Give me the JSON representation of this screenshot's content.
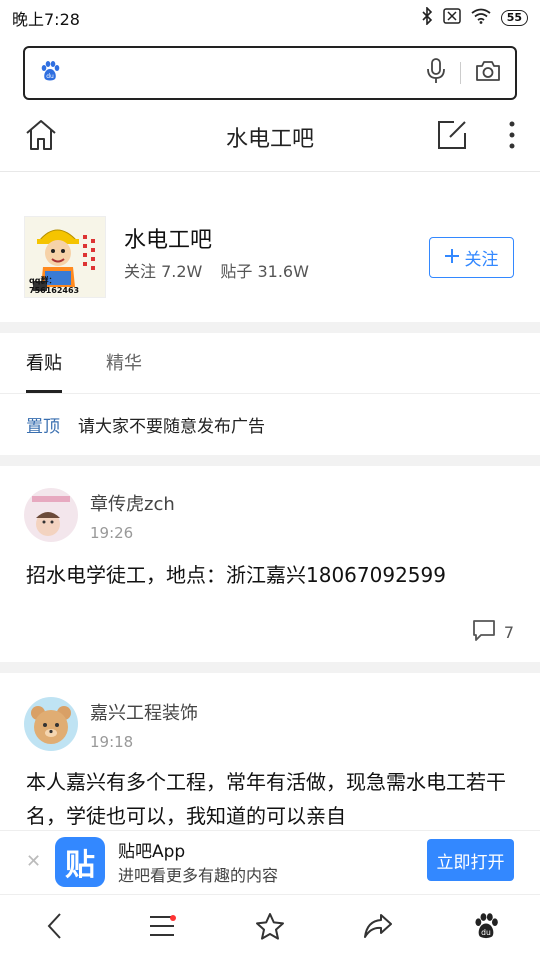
{
  "status_bar": {
    "time": "晚上7:28",
    "battery": "55"
  },
  "search": {
    "placeholder": ""
  },
  "header": {
    "title": "水电工吧"
  },
  "forum": {
    "name": "水电工吧",
    "followers_label": "关注",
    "followers_count": "7.2W",
    "posts_label": "贴子",
    "posts_count": "31.6W",
    "avatar_caption": "qq群：756162463",
    "follow_label": "关注"
  },
  "tabs": [
    {
      "label": "看贴",
      "active": true
    },
    {
      "label": "精华",
      "active": false
    }
  ],
  "pinned": {
    "tag": "置顶",
    "title": "请大家不要随意发布广告"
  },
  "posts": [
    {
      "author": "章传虎zch",
      "time": "19:26",
      "content": "招水电学徒工，地点：浙江嘉兴18067092599",
      "comments": "7"
    },
    {
      "author": "嘉兴工程装饰",
      "time": "19:18",
      "content": "本人嘉兴有多个工程，常年有活做，现急需水电工若干名，学徒也可以，我知道的可以亲自"
    }
  ],
  "app_banner": {
    "icon_text": "贴",
    "app_name": "贴吧App",
    "description": "进吧看更多有趣的内容",
    "open_label": "立即打开"
  },
  "colors": {
    "accent": "#3388ff",
    "pinned_tag": "#3a6fb0"
  },
  "icons": [
    "bluetooth-icon",
    "mute-icon",
    "wifi-icon",
    "baidu-paw-icon",
    "microphone-icon",
    "camera-icon",
    "home-icon",
    "edit-icon",
    "more-icon",
    "comment-icon",
    "back-icon",
    "menu-icon",
    "star-icon",
    "share-icon"
  ]
}
